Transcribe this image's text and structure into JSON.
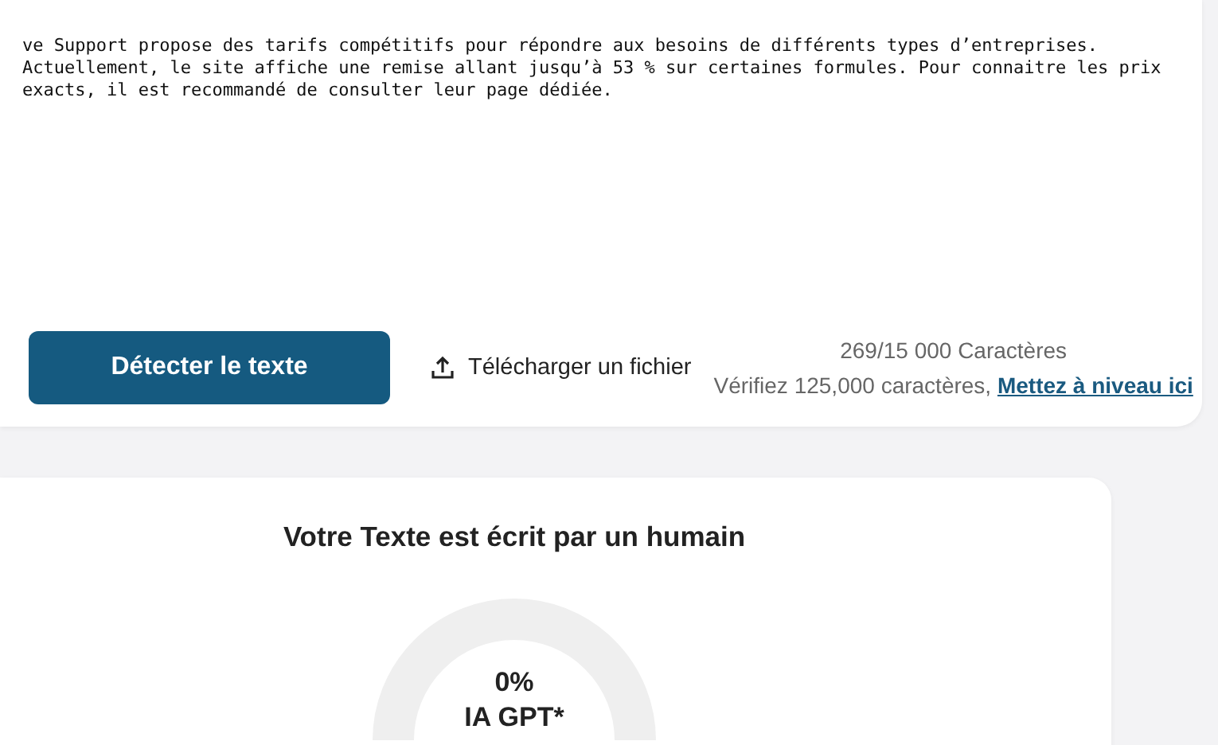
{
  "editor": {
    "lines": [
      "ve Support propose des tarifs compétitifs pour répondre aux besoins de différents types d’entreprises.",
      "Actuellement, le site affiche une remise allant jusqu’à 53 % sur certaines formules. Pour connaitre les prix",
      "exacts, il est recommandé de consulter leur page dédiée."
    ]
  },
  "actions": {
    "detect_button": "Détecter le texte",
    "upload_button": "Télécharger un fichier",
    "counter": "269/15 000 Caractères",
    "upgrade_note": "Vérifiez 125,000 caractères,",
    "upgrade_link": "Mettez à niveau ici"
  },
  "result": {
    "title": "Votre Texte est écrit par un humain",
    "gauge": {
      "value": "0%",
      "label": "IA GPT*"
    }
  }
}
